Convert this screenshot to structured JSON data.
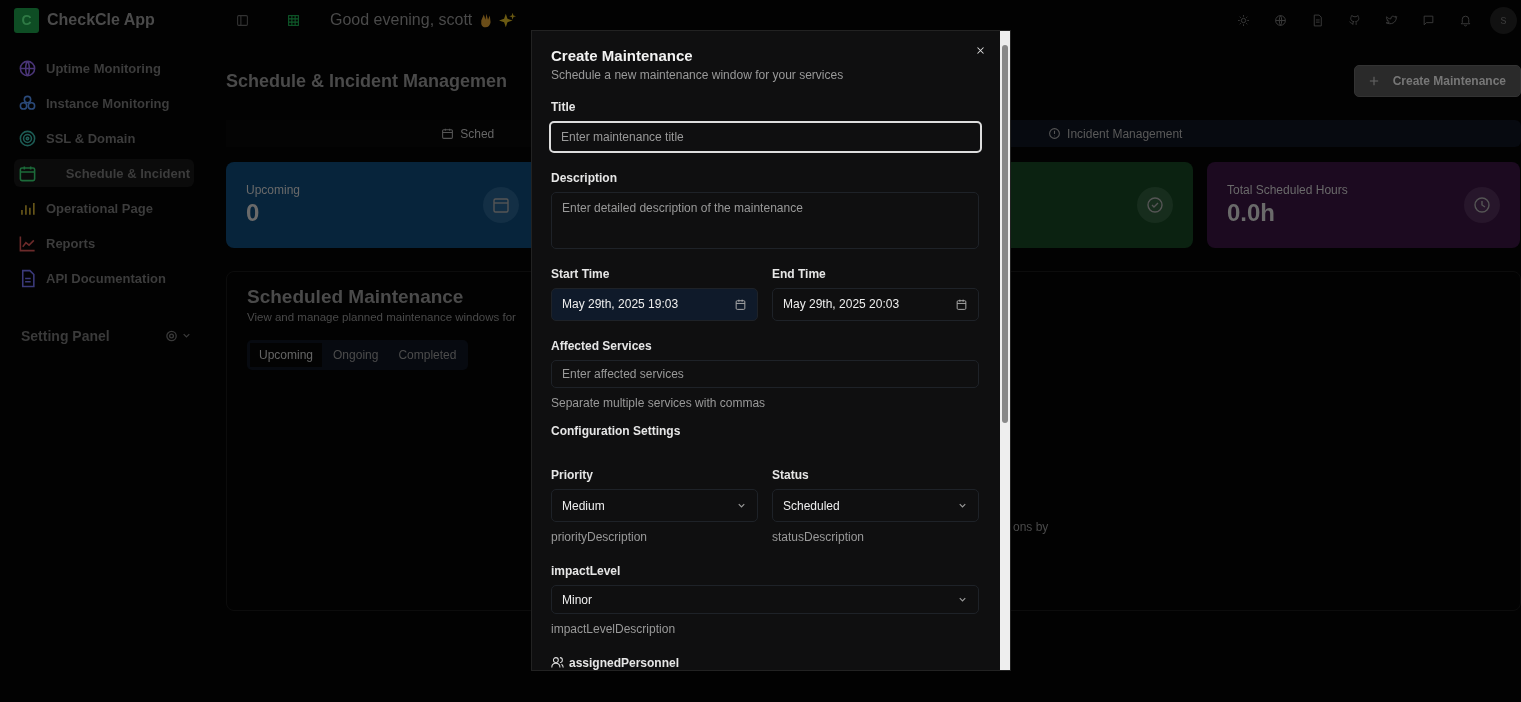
{
  "app": {
    "logo_letter": "C",
    "name": "CheckCle App"
  },
  "header": {
    "greeting": "Good evening, scott",
    "avatar": "s"
  },
  "sidebar": {
    "items": [
      {
        "label": "Uptime Monitoring",
        "color": "#4a3577",
        "selected": false
      },
      {
        "label": "Instance Monitoring",
        "color": "#2b4a7a",
        "selected": false
      },
      {
        "label": "SSL & Domain",
        "color": "#1d5c55",
        "selected": false
      },
      {
        "label": "Schedule & Incident",
        "color": "#1c6b3a",
        "selected": true
      },
      {
        "label": "Operational Page",
        "color": "#6b5a1a",
        "selected": false
      },
      {
        "label": "Reports",
        "color": "#6b2a2a",
        "selected": false
      },
      {
        "label": "API Documentation",
        "color": "#3b3a7a",
        "selected": false
      }
    ],
    "settings_label": "Setting Panel"
  },
  "page": {
    "title": "Schedule & Incident Managemen",
    "create_button": "Create Maintenance",
    "tabs": [
      {
        "label": "Sched",
        "selected": true
      },
      {
        "label": "Incident Management",
        "selected": false
      }
    ],
    "cards": [
      {
        "label": "Upcoming",
        "value": "0",
        "color": "#07243b"
      },
      {
        "color": "#0b2211"
      },
      {
        "label": "Total Scheduled Hours",
        "value": "0.0h",
        "color": "#1c0a20"
      }
    ],
    "panel": {
      "title": "Scheduled Maintenance",
      "subtitle": "View and manage planned maintenance windows for",
      "tabs": [
        {
          "label": "Upcoming",
          "selected": true
        },
        {
          "label": "Ongoing",
          "selected": false
        },
        {
          "label": "Completed",
          "selected": false
        }
      ],
      "empty_text": "ons by"
    }
  },
  "modal": {
    "title": "Create Maintenance",
    "subtitle": "Schedule a new maintenance window for your services",
    "title_field": {
      "label": "Title",
      "placeholder": "Enter maintenance title",
      "focused": true
    },
    "description_field": {
      "label": "Description",
      "placeholder": "Enter detailed description of the maintenance"
    },
    "start_time": {
      "label": "Start Time",
      "value": "May 29th, 2025 19:03",
      "highlighted": true
    },
    "end_time": {
      "label": "End Time",
      "value": "May 29th, 2025 20:03",
      "highlighted": false
    },
    "affected_services": {
      "label": "Affected Services",
      "placeholder": "Enter affected services",
      "hint": "Separate multiple services with commas"
    },
    "section": "Configuration Settings",
    "priority": {
      "label": "Priority",
      "value": "Medium",
      "hint": "priorityDescription"
    },
    "status": {
      "label": "Status",
      "value": "Scheduled",
      "hint": "statusDescription"
    },
    "impact_level": {
      "label": "impactLevel",
      "value": "Minor",
      "hint": "impactLevelDescription"
    },
    "assigned_personnel": {
      "label": "assignedPersonnel"
    }
  }
}
